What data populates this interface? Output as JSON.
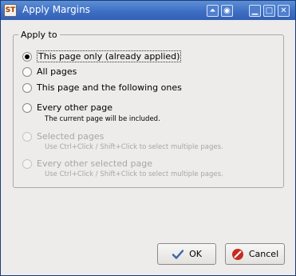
{
  "window": {
    "title": "Apply Margins",
    "app_icon_text": "ST",
    "buttons": {
      "shade": "⏶",
      "restore_alt": "◉",
      "minimize": "▁",
      "maximize": "□",
      "close": "✕"
    }
  },
  "group": {
    "title": "Apply to"
  },
  "options": [
    {
      "label": "This page only (already applied)",
      "selected": true,
      "enabled": true
    },
    {
      "label": "All pages",
      "selected": false,
      "enabled": true
    },
    {
      "label": "This page and the following ones",
      "selected": false,
      "enabled": true
    },
    {
      "label": "Every other page",
      "selected": false,
      "enabled": true,
      "hint": "The current page will be included."
    },
    {
      "label": "Selected pages",
      "selected": false,
      "enabled": false,
      "hint": "Use Ctrl+Click / Shift+Click to select multiple pages."
    },
    {
      "label": "Every other selected page",
      "selected": false,
      "enabled": false,
      "hint": "Use Ctrl+Click / Shift+Click to select multiple pages."
    }
  ],
  "actions": {
    "ok_label": "OK",
    "cancel_label": "Cancel"
  },
  "colors": {
    "titlebar": "#3e6fc4",
    "ok_check": "#3f63a8",
    "cancel_icon": "#c62b20"
  }
}
